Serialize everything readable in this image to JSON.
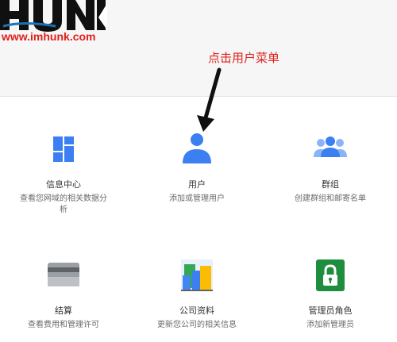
{
  "logo": {
    "wordmark": "HUNK",
    "url": "www.imhunk.com"
  },
  "annotation": {
    "text": "点击用户菜单",
    "color": "#e0201b"
  },
  "cards": [
    {
      "title": "信息中心",
      "desc": "查看您网域的相关数据分析",
      "icon": "dashboard-icon"
    },
    {
      "title": "用户",
      "desc": "添加或管理用户",
      "icon": "user-icon"
    },
    {
      "title": "群组",
      "desc": "创建群组和邮寄名单",
      "icon": "group-icon"
    },
    {
      "title": "结算",
      "desc": "查看费用和管理许可",
      "icon": "billing-card-icon"
    },
    {
      "title": "公司资料",
      "desc": "更新您公司的相关信息",
      "icon": "company-buildings-icon"
    },
    {
      "title": "管理员角色",
      "desc": "添加新管理员",
      "icon": "admin-lock-icon"
    }
  ],
  "colors": {
    "primary_blue": "#3b7ff2",
    "light_blue": "#8ab4f8",
    "admin_green": "#1e8e3e"
  }
}
